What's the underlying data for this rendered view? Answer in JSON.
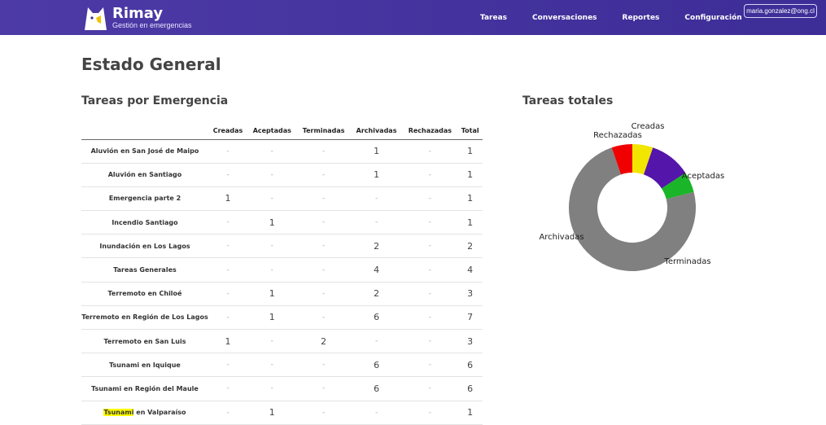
{
  "brand": {
    "name": "Rimay",
    "subtitle": "Gestión en emergencias"
  },
  "nav": {
    "items": [
      "Tareas",
      "Conversaciones",
      "Reportes",
      "Configuración"
    ]
  },
  "user": {
    "email": "maria.gonzalez@ong.cl"
  },
  "page": {
    "title": "Estado General"
  },
  "table": {
    "title": "Tareas por Emergencia",
    "columns": [
      "",
      "Creadas",
      "Aceptadas",
      "Terminadas",
      "Archivadas",
      "Rechazadas",
      "Total"
    ],
    "rows": [
      [
        "Aluvión en San José de Maipo",
        "-",
        "-",
        "-",
        "1",
        "-",
        "1"
      ],
      [
        "Aluvión en Santiago",
        "-",
        "-",
        "-",
        "1",
        "-",
        "1"
      ],
      [
        "Emergencia parte 2",
        "1",
        "-",
        "-",
        "-",
        "-",
        "1"
      ],
      [
        "Incendio Santiago",
        "-",
        "1",
        "-",
        "-",
        "-",
        "1"
      ],
      [
        "Inundación en Los Lagos",
        "-",
        "-",
        "-",
        "2",
        "-",
        "2"
      ],
      [
        "Tareas Generales",
        "-",
        "-",
        "-",
        "4",
        "-",
        "4"
      ],
      [
        "Terremoto en Chiloé",
        "-",
        "1",
        "-",
        "2",
        "-",
        "3"
      ],
      [
        "Terremoto en Región de Los Lagos",
        "-",
        "1",
        "-",
        "6",
        "-",
        "7"
      ],
      [
        "Terremoto en San Luis",
        "1",
        "-",
        "2",
        "-",
        "-",
        "3"
      ],
      [
        "Tsunami en Iquique",
        "-",
        "-",
        "-",
        "6",
        "-",
        "6"
      ],
      [
        "Tsunami en Región del Maule",
        "-",
        "-",
        "-",
        "6",
        "-",
        "6"
      ],
      [
        "Tsunami en Valparaíso",
        "-",
        "1",
        "-",
        "-",
        "-",
        "1"
      ]
    ]
  },
  "chart_data": {
    "type": "pie",
    "title": "Tareas totales",
    "categories": [
      "Creadas",
      "Aceptadas",
      "Terminadas",
      "Archivadas",
      "Rechazadas"
    ],
    "values": [
      2,
      4,
      2,
      28,
      2
    ],
    "colors": [
      "#f2e500",
      "#5415aa",
      "#1ab528",
      "#808080",
      "#f00000"
    ]
  }
}
